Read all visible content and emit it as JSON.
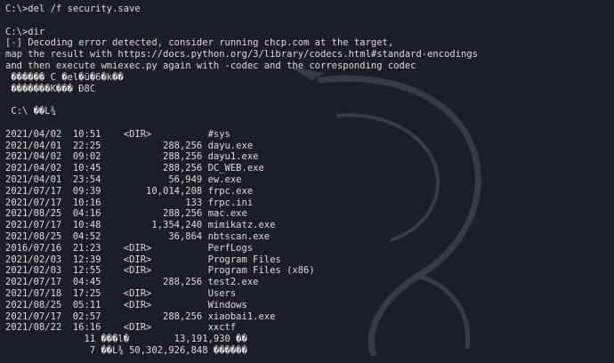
{
  "terminal": {
    "cmd1": "C:\\>del /f security.save",
    "cmd2": "C:\\>dir",
    "error_lines": [
      "[-] Decoding error detected, consider running chcp.com at the target,",
      "map the result with https://docs.python.org/3/library/codecs.html#standard-encodings",
      "and then execute wmiexec.py again with -codec and the corresponding codec"
    ],
    "garbled_lines": [
      " ������ C �el�ū�6�k��",
      " �������K��� Ɖ8C"
    ],
    "dir_header": " C:\\ ��L¾",
    "listing": [
      "2021/04/02  10:51    <DIR>          #sys",
      "2021/04/01  22:25           288,256 dayu.exe",
      "2021/04/02  09:02           288,256 dayu1.exe",
      "2021/04/02  10:45           288,256 DC_WEB.exe",
      "2021/04/01  23:54            56,949 ew.exe",
      "2021/07/17  09:39        10,014,208 frpc.exe",
      "2021/07/17  10:16               133 frpc.ini",
      "2021/08/25  04:16           288,256 mac.exe",
      "2021/07/17  10:48         1,354,240 mimikatz.exe",
      "2021/08/25  04:52            36,864 nbtscan.exe",
      "2016/07/16  21:23    <DIR>          PerfLogs",
      "2021/02/03  12:39    <DIR>          Program Files",
      "2021/02/03  12:55    <DIR>          Program Files (x86)",
      "2021/07/17  04:45           288,256 test2.exe",
      "2021/07/18  17:25    <DIR>          Users",
      "2021/08/25  05:11    <DIR>          Windows",
      "2021/07/17  02:57           288,256 xiaobai1.exe",
      "2021/08/22  16:16    <DIR>          xxctf"
    ],
    "summary": [
      "              11 ���l�        13,191,930 ��",
      "               7 ��L¾ 50,302,926,848 ������"
    ]
  },
  "colors": {
    "background": "#1b1e24",
    "text": "#dcdcdc"
  }
}
